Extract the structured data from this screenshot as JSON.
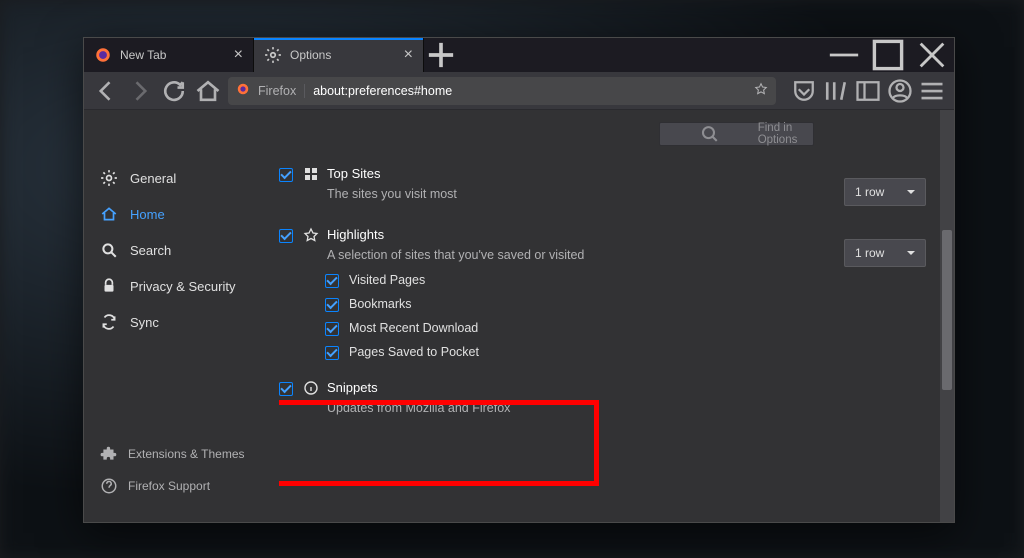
{
  "tabs": [
    {
      "label": "New Tab",
      "active": false
    },
    {
      "label": "Options",
      "active": true
    }
  ],
  "urlbar": {
    "prefix": "Firefox",
    "url": "about:preferences#home"
  },
  "find": {
    "placeholder": "Find in Options"
  },
  "sidebar": {
    "items": [
      {
        "label": "General",
        "icon": "gear"
      },
      {
        "label": "Home",
        "icon": "home",
        "active": true
      },
      {
        "label": "Search",
        "icon": "search"
      },
      {
        "label": "Privacy & Security",
        "icon": "lock"
      },
      {
        "label": "Sync",
        "icon": "sync"
      }
    ],
    "bottom": [
      {
        "label": "Extensions & Themes",
        "icon": "puzzle"
      },
      {
        "label": "Firefox Support",
        "icon": "help"
      }
    ]
  },
  "sections": {
    "topsites": {
      "title": "Top Sites",
      "desc": "The sites you visit most",
      "checked": true,
      "dropdown": "1 row"
    },
    "highlights": {
      "title": "Highlights",
      "desc": "A selection of sites that you've saved or visited",
      "checked": true,
      "dropdown": "1 row",
      "items": [
        {
          "label": "Visited Pages",
          "checked": true
        },
        {
          "label": "Bookmarks",
          "checked": true
        },
        {
          "label": "Most Recent Download",
          "checked": true
        },
        {
          "label": "Pages Saved to Pocket",
          "checked": true
        }
      ]
    },
    "snippets": {
      "title": "Snippets",
      "desc": "Updates from Mozilla and Firefox",
      "checked": true
    }
  }
}
